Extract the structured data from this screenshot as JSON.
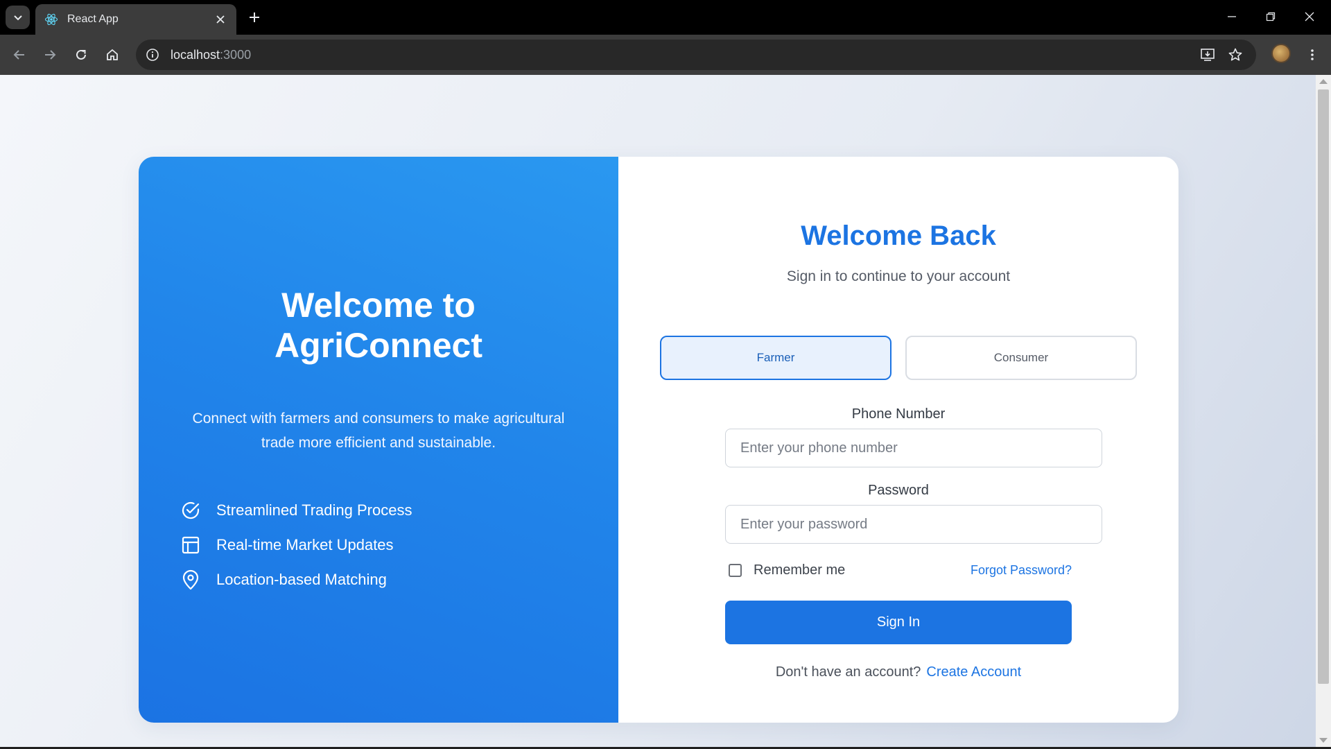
{
  "browser": {
    "tab_title": "React App",
    "url_host": "localhost",
    "url_port": ":3000"
  },
  "hero": {
    "title_line1": "Welcome to",
    "title_line2": "AgriConnect",
    "description": "Connect with farmers and consumers to make agricultural trade more efficient and sustainable.",
    "features": [
      {
        "icon": "check-circle-icon",
        "label": "Streamlined Trading Process"
      },
      {
        "icon": "layout-icon",
        "label": "Real-time Market Updates"
      },
      {
        "icon": "map-pin-icon",
        "label": "Location-based Matching"
      }
    ]
  },
  "login": {
    "title": "Welcome Back",
    "subtitle": "Sign in to continue to your account",
    "roles": [
      {
        "label": "Farmer",
        "selected": true
      },
      {
        "label": "Consumer",
        "selected": false
      }
    ],
    "phone_label": "Phone Number",
    "phone_placeholder": "Enter your phone number",
    "password_label": "Password",
    "password_placeholder": "Enter your password",
    "remember_label": "Remember me",
    "remember_checked": false,
    "forgot_label": "Forgot Password?",
    "signin_label": "Sign In",
    "no_account_text": "Don't have an account?",
    "create_account_label": "Create Account"
  },
  "colors": {
    "primary": "#1c74e2",
    "hero_gradient_start": "#2a98f0",
    "hero_gradient_end": "#1b73e3",
    "selected_role_bg": "#e8f1fd"
  }
}
